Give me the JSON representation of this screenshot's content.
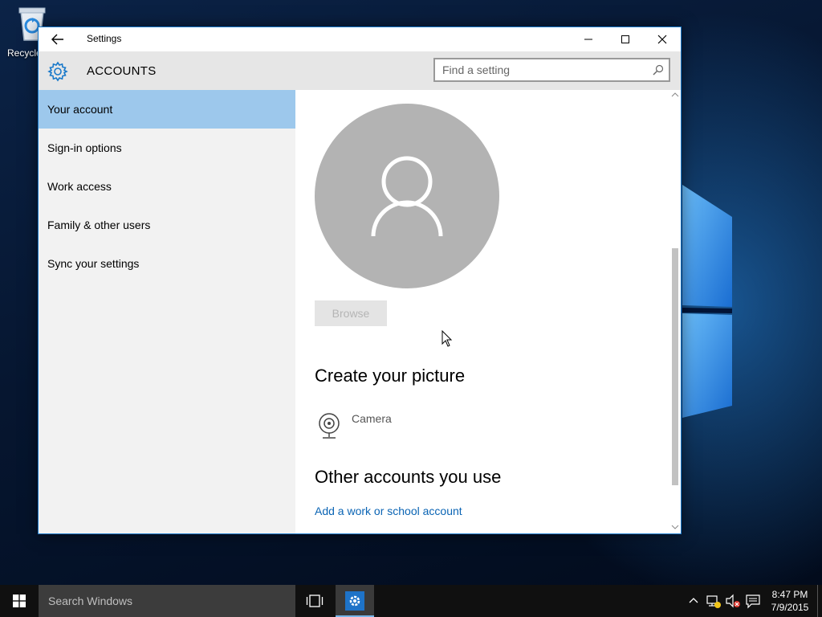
{
  "desktop": {
    "recycle_bin_label": "Recycle"
  },
  "window": {
    "title": "Settings",
    "section_title": "ACCOUNTS",
    "search_placeholder": "Find a setting"
  },
  "nav": {
    "items": [
      {
        "label": "Your account",
        "active": true
      },
      {
        "label": "Sign-in options",
        "active": false
      },
      {
        "label": "Work access",
        "active": false
      },
      {
        "label": "Family & other users",
        "active": false
      },
      {
        "label": "Sync your settings",
        "active": false
      }
    ]
  },
  "content": {
    "browse_label": "Browse",
    "create_picture_heading": "Create your picture",
    "camera_label": "Camera",
    "other_accounts_heading": "Other accounts you use",
    "add_account_link": "Add a work or school account"
  },
  "taskbar": {
    "search_placeholder": "Search Windows",
    "time": "8:47 PM",
    "date": "7/9/2015"
  },
  "colors": {
    "accent": "#1979ca",
    "nav_active": "#9dc8ec",
    "link": "#0a64b4",
    "avatar_bg": "#b3b3b3"
  }
}
